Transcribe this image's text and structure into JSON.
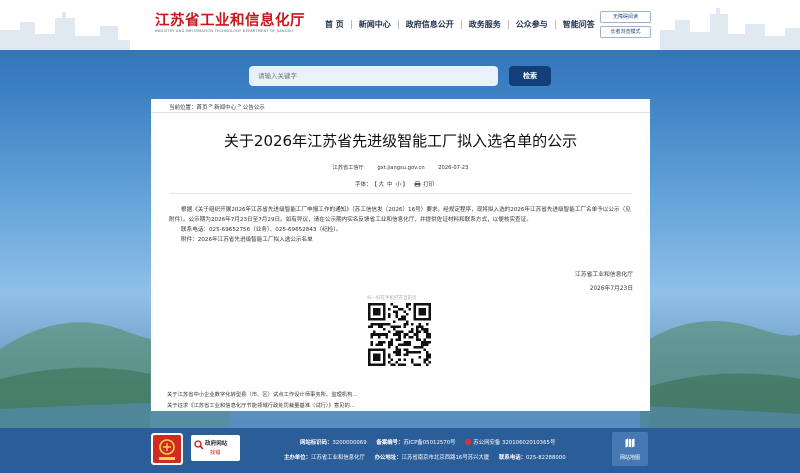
{
  "header": {
    "logo_cn": "江苏省工业和信息化厅",
    "logo_en": "INDUSTRY AND INFORMATION TECHNOLOGY DEPARTMENT OF JIANGSU",
    "nav": [
      "首 页",
      "新闻中心",
      "政府信息公开",
      "政务服务",
      "公众参与",
      "智能问答"
    ],
    "mode_buttons": [
      "无障碍阅读",
      "长者浏览模式"
    ]
  },
  "search": {
    "placeholder": "请输入关键字",
    "button": "检索"
  },
  "article": {
    "breadcrumb_label": "当前位置：",
    "breadcrumb": [
      "首页",
      "新闻中心",
      "公告公示"
    ],
    "title": "关于2026年江苏省先进级智能工厂拟入选名单的公示",
    "source": "江苏省工信厅",
    "site": "gxt.jiangsu.gov.cn",
    "date": "2026-07-23",
    "font_label": "字体：",
    "font_large": "大",
    "font_medium": "中",
    "font_small": "小",
    "print_label": "打印",
    "paragraph1": "根据《关于组织开展2026年江苏省先进级智能工厂申报工作的通知》（苏工信信发〔2026〕16号）要求，经规定程序，现将拟入选的2026年江苏省先进级智能工厂名单予以公示（见附件）。公示期为2026年7月23日至7月29日。如有异议，请在公示期内实名反馈省工业和信息化厅，并提供佐证材料和联系方式，以便核实查证。",
    "contact": "联系电话：025-69652756（业务）、025-69652843（纪检）。",
    "attachment": "附件：2026年江苏省先进级智能工厂拟入选公示名单",
    "sign_org": "江苏省工业和信息化厅",
    "sign_date": "2026年7月23日",
    "qr_label": "扫一扫在手机打开当前页",
    "related": [
      "关于江苏省中小企业数字化转型县（市、区）试点工作设计师事务所、监理机构...",
      "关于征求《江苏省工业和信息化厅节能领域行政处罚裁量基准（试行）》意见的..."
    ]
  },
  "footer": {
    "badge_gov_icon": "党政机关",
    "badge_err_title": "政府网站",
    "badge_err_sub": "找错",
    "site_id_label": "网站标识码：",
    "site_id": "3200000069",
    "icp_label": "备案编号：",
    "icp": "苏ICP备05012570号",
    "police": "苏公网安备 32010602010365号",
    "host_label": "主办单位：",
    "host": "江苏省工业和信息化厅",
    "address_label": "办公地址：",
    "address": "江苏省南京市北京西路16号苏兴大厦",
    "phone_label": "联系电话：",
    "phone": "025-82288000",
    "map_label": "网站地图"
  },
  "colors": {
    "brand_red": "#c8161d",
    "nav_dark": "#1c2e4a",
    "search_btn": "#123f7a",
    "footer": "#2b5d98"
  }
}
